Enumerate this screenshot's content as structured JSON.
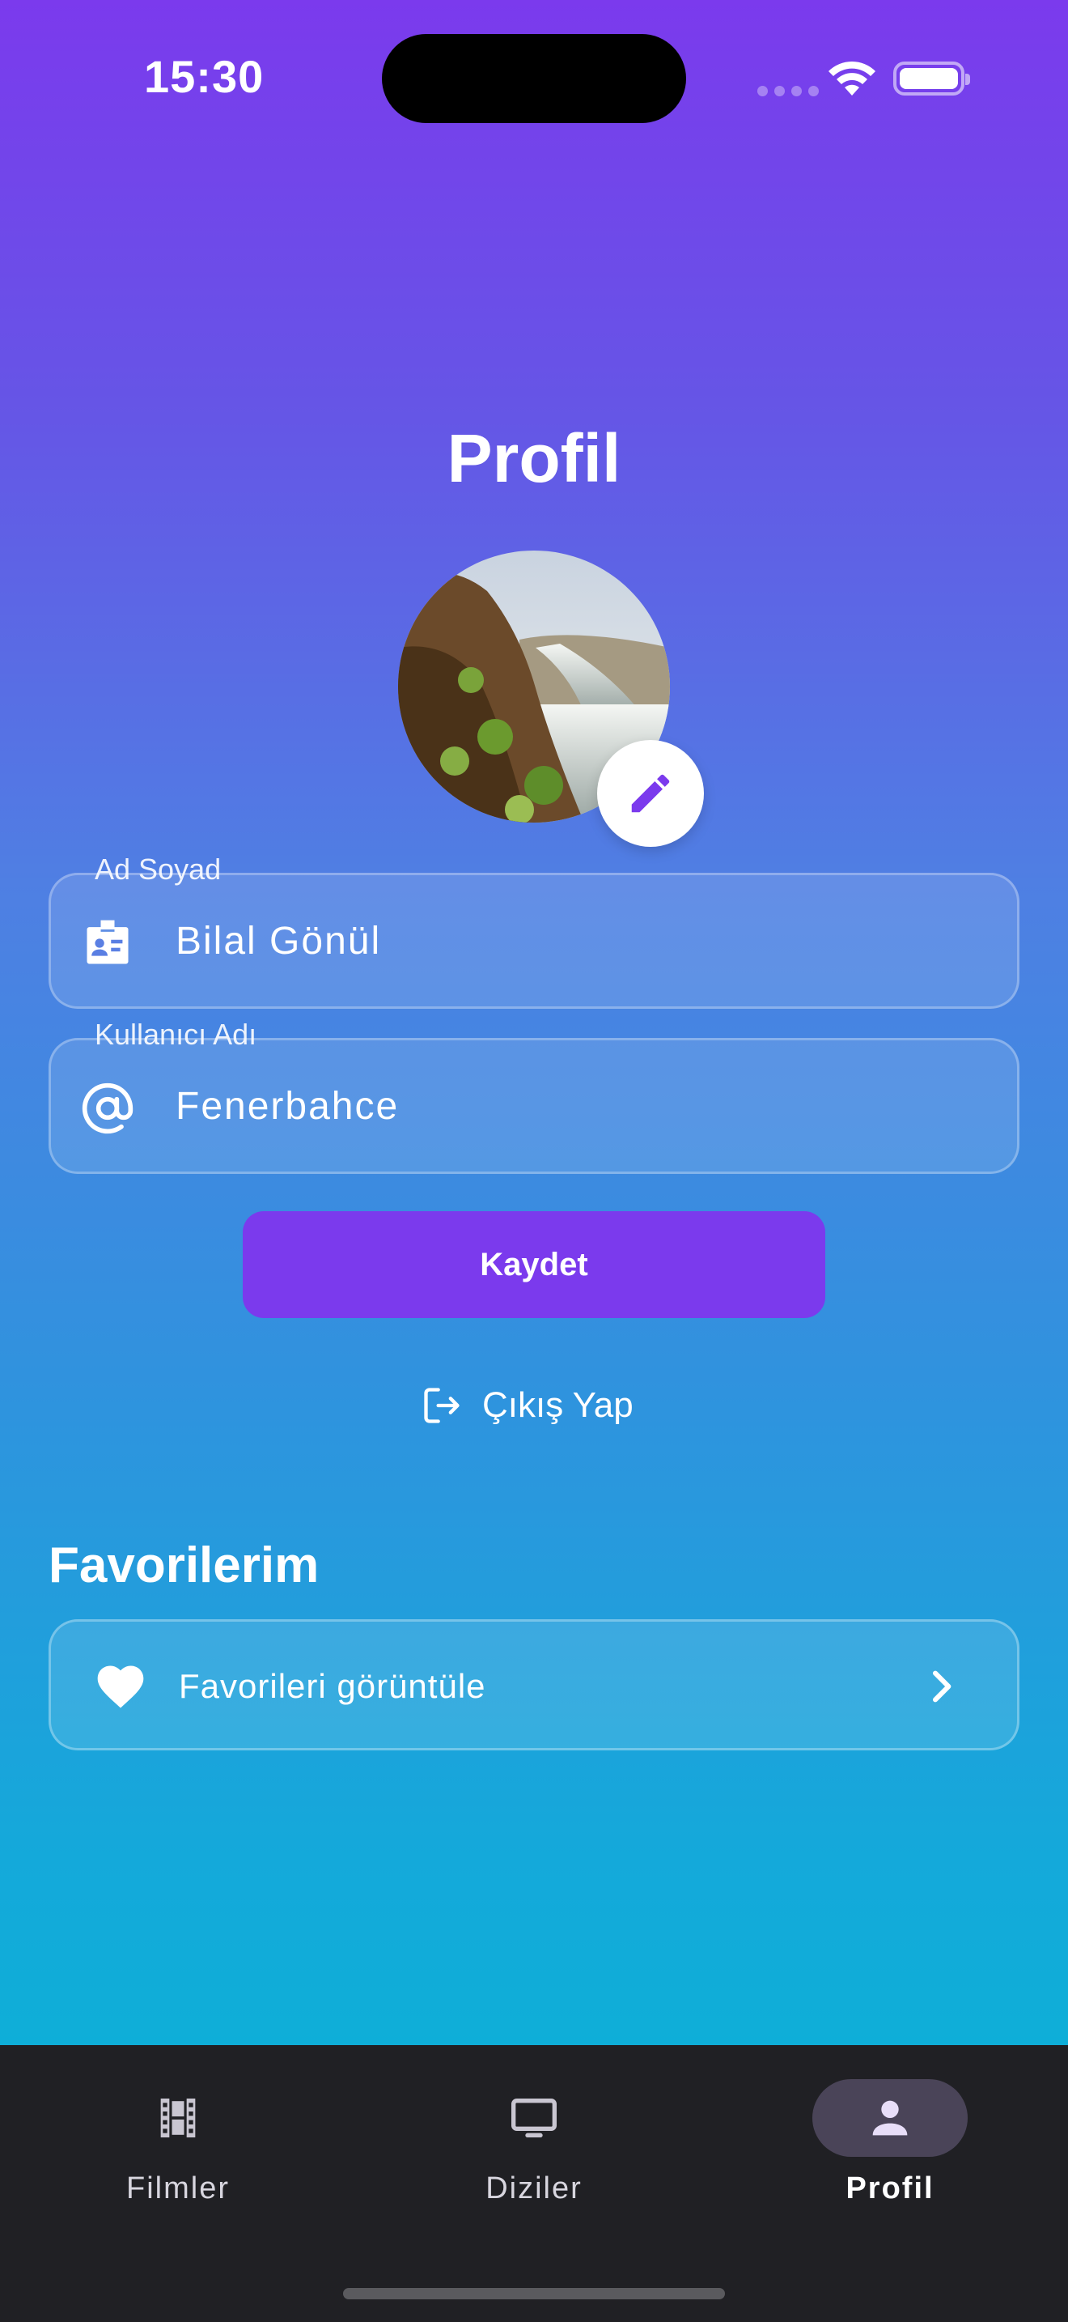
{
  "status_bar": {
    "time": "15:30"
  },
  "page": {
    "title": "Profil"
  },
  "form": {
    "full_name": {
      "label": "Ad Soyad",
      "value": "Bilal Gönül",
      "icon": "id-badge-icon"
    },
    "username": {
      "label": "Kullanıcı Adı",
      "value": "Fenerbahce",
      "icon": "at-sign-icon"
    },
    "save_label": "Kaydet"
  },
  "logout": {
    "label": "Çıkış Yap",
    "icon": "logout-icon"
  },
  "favorites": {
    "section_title": "Favorilerim",
    "card_label": "Favorileri görüntüle",
    "icon": "heart-icon"
  },
  "bottom_nav": {
    "items": [
      {
        "label": "Filmler",
        "icon": "film-icon",
        "active": false
      },
      {
        "label": "Diziler",
        "icon": "tv-icon",
        "active": false
      },
      {
        "label": "Profil",
        "icon": "person-icon",
        "active": true
      }
    ]
  },
  "colors": {
    "accent": "#7B3AED",
    "gradient_top": "#7B3AED",
    "gradient_bottom": "#06B6D4",
    "nav_background": "#202024",
    "nav_active_pill": "#4A4458"
  }
}
